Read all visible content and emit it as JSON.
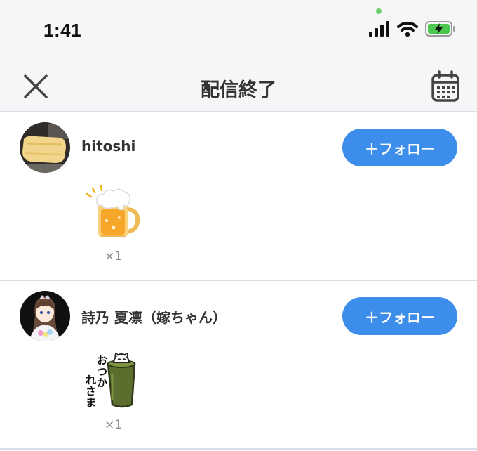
{
  "status_bar": {
    "time": "1:41"
  },
  "nav": {
    "title": "配信終了"
  },
  "users": [
    {
      "name": "hitoshi",
      "follow_label": "＋フォロー",
      "gift_count": "×1",
      "gift_icon": "beer-mug-icon"
    },
    {
      "name": "詩乃 夏凛（嫁ちゃん）",
      "follow_label": "＋フォロー",
      "gift_count": "×1",
      "gift_icon": "otsukaresama-cup-icon",
      "gift_text": "おつかれさま"
    }
  ],
  "colors": {
    "accent": "#3d8eea",
    "battery": "#4cc850"
  }
}
